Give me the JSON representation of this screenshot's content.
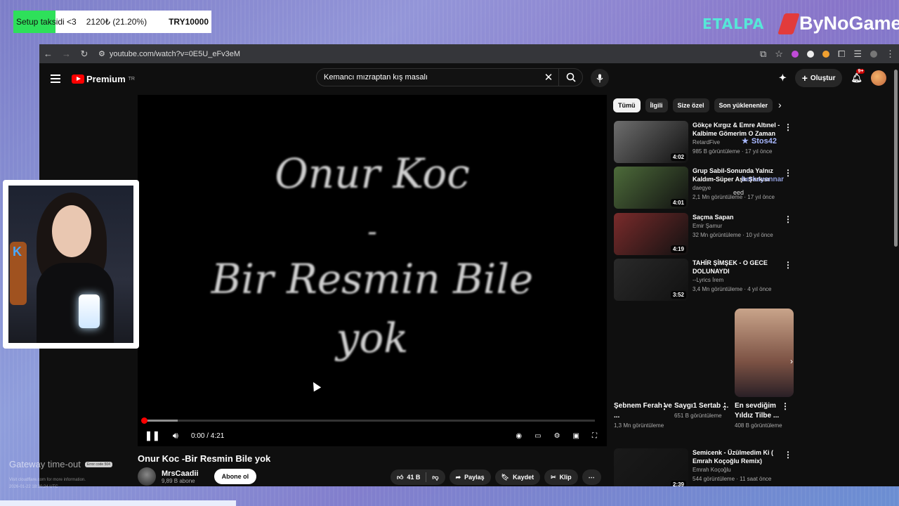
{
  "donation": {
    "title": "Setup taksidi <3",
    "amount": "2120₺ (21.20%)",
    "goal": "TRY10000",
    "progress": 0.212
  },
  "overlay": {
    "logo1": "ETALPA",
    "logo2": "ByNoGame"
  },
  "browser": {
    "url": "youtube.com/watch?v=0E5U_eFv3eM"
  },
  "youtube": {
    "logo": "Premium",
    "logo_sup": "TR",
    "search_value": "Kemancı mızraptan kış masalı",
    "create_label": "Oluştur",
    "notif_badge": "9+"
  },
  "player": {
    "art_line1": "Onur Koc",
    "art_line2": "-",
    "art_line3": "Bir Resmin Bile",
    "art_line4": "yok",
    "time": "0:00 / 4:21",
    "progress_fraction": 0.0,
    "buffered_fraction": 0.075
  },
  "video": {
    "title": "Onur Koc -Bir Resmin Bile yok",
    "channel": "MrsCaadii",
    "subs": "9,89 B abone",
    "subscribe_label": "Abone ol",
    "likes": "41 B",
    "share_label": "Paylaş",
    "save_label": "Kaydet",
    "clip_label": "Klip"
  },
  "chips": [
    "Tümü",
    "İlgili",
    "Size özel",
    "Son yüklenenler"
  ],
  "recommendations": [
    {
      "title": "Gökçe Kırgız & Emre Altınel - Kalbime Gömerim O Zaman",
      "channel": "RetardFive",
      "meta": "985 B görüntüleme · 17 yıl önce",
      "duration": "4:02",
      "thumb": "#6e6e6e"
    },
    {
      "title": "Grup Sabil-Sonunda Yalnız Kaldım-Süper Aşk Şarkısı",
      "channel": "daegye",
      "meta": "2,1 Mn görüntüleme · 17 yıl önce",
      "duration": "4:01",
      "thumb": "#4d6b3a"
    },
    {
      "title": "Saçma Sapan",
      "channel": "Emir Şamur",
      "meta": "32 Mn görüntüleme · 10 yıl önce",
      "duration": "4:19",
      "thumb": "#7a2b2b"
    },
    {
      "title": "TAHİR ŞİMŞEK - O GECE DOLUNAYDI",
      "channel": "--Lyrics İrem",
      "meta": "3,4 Mn görüntüleme · 4 yıl önce",
      "duration": "3:52",
      "thumb": "#2a2a2a"
    },
    {
      "title": "Semicenk - Üzülmedim Ki ( Emrah Koçoğlu Remix)",
      "channel": "Emrah Koçoğlu",
      "meta": "544 görüntüleme · 11 saat önce",
      "duration": "2:39",
      "thumb": "#1a1a1a"
    }
  ],
  "shorts": [
    {
      "title": "Şebnem Ferah ve ...",
      "views": "1,3 Mn görüntüleme"
    },
    {
      "title": "Saygı1 Sertab ...",
      "views": "651 B görüntüleme"
    },
    {
      "title": "En sevdiğim Yıldız Tilbe ...",
      "views": "408 B görüntüleme"
    }
  ],
  "chat": {
    "user1": "Stos42",
    "user2": "berkayonnar",
    "msg": "eed"
  },
  "error": {
    "text": "Gateway time-out",
    "code": "Error code 504",
    "sub1": "Visit cloudflare.com for more information.",
    "sub2": "2026-01-22 18:20:24 UTC"
  }
}
